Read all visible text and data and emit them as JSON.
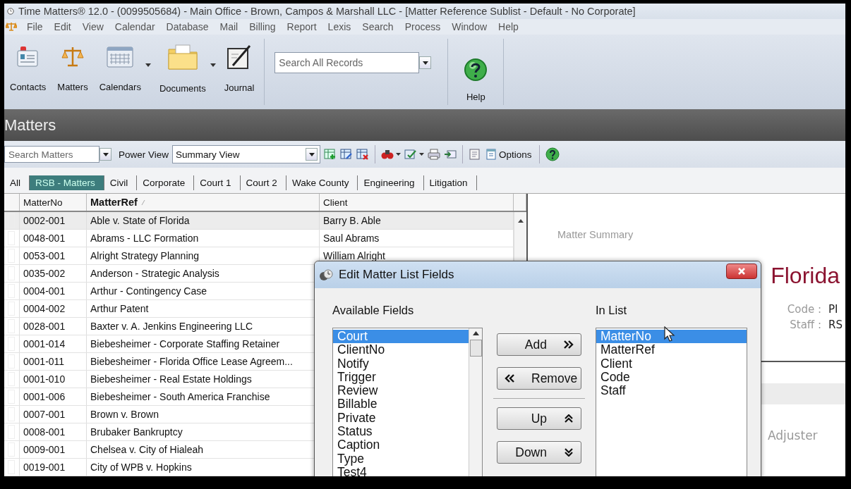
{
  "window": {
    "title": "Time Matters® 12.0 - (0099505684) - Main Office - Brown, Campos & Marshall LLC - [Matter Reference Sublist - Default - No Corporate]"
  },
  "menu": [
    "File",
    "Edit",
    "View",
    "Calendar",
    "Database",
    "Mail",
    "Billing",
    "Report",
    "Lexis",
    "Search",
    "Process",
    "Window",
    "Help"
  ],
  "toolbar": {
    "buttons": [
      {
        "label": "Contacts",
        "kind": "contacts",
        "dropdown": false
      },
      {
        "label": "Matters",
        "kind": "matters",
        "dropdown": false
      },
      {
        "label": "Calendars",
        "kind": "calendars",
        "dropdown": true
      },
      {
        "label": "Documents",
        "kind": "documents",
        "dropdown": true
      },
      {
        "label": "Journal",
        "kind": "journal",
        "dropdown": false
      }
    ],
    "search": {
      "placeholder": "Search All Records"
    },
    "help": {
      "label": "Help"
    }
  },
  "section": {
    "title": "Matters"
  },
  "list_toolbar": {
    "search": {
      "placeholder": "Search Matters"
    },
    "power_view_label": "Power View",
    "view": {
      "value": "Summary View"
    },
    "options_label": "Options"
  },
  "tabs": [
    {
      "label": "All",
      "selected": false
    },
    {
      "label": "RSB - Matters",
      "selected": true
    },
    {
      "label": "Civil",
      "selected": false
    },
    {
      "label": "Corporate",
      "selected": false
    },
    {
      "label": "Court 1",
      "selected": false
    },
    {
      "label": "Court 2",
      "selected": false
    },
    {
      "label": "Wake County",
      "selected": false
    },
    {
      "label": "Engineering",
      "selected": false
    },
    {
      "label": "Litigation",
      "selected": false
    }
  ],
  "table": {
    "columns": [
      {
        "label": "MatterNo",
        "sorted": false
      },
      {
        "label": "MatterRef",
        "sorted": true
      },
      {
        "label": "Client",
        "sorted": false
      }
    ],
    "rows": [
      {
        "matter_no": "0002-001",
        "matter_ref": "Able v. State of Florida",
        "client": "Barry B. Able",
        "selected": true
      },
      {
        "matter_no": "0048-001",
        "matter_ref": "Abrams - LLC Formation",
        "client": "Saul Abrams",
        "selected": false
      },
      {
        "matter_no": "0053-001",
        "matter_ref": "Alright Strategy Planning",
        "client": "William Alright",
        "selected": false
      },
      {
        "matter_no": "0035-002",
        "matter_ref": "Anderson - Strategic Analysis",
        "selected": false
      },
      {
        "matter_no": "0004-001",
        "matter_ref": "Arthur - Contingency Case",
        "selected": false
      },
      {
        "matter_no": "0004-002",
        "matter_ref": "Arthur Patent",
        "selected": false
      },
      {
        "matter_no": "0028-001",
        "matter_ref": "Baxter v. A. Jenkins Engineering LLC",
        "selected": false
      },
      {
        "matter_no": "0001-014",
        "matter_ref": "Biebesheimer - Corporate Staffing Retainer",
        "selected": false
      },
      {
        "matter_no": "0001-011",
        "matter_ref": "Biebesheimer - Florida Office Lease Agreem...",
        "selected": false
      },
      {
        "matter_no": "0001-010",
        "matter_ref": "Biebesheimer - Real Estate Holdings",
        "selected": false
      },
      {
        "matter_no": "0001-006",
        "matter_ref": "Biebesheimer - South America Franchise",
        "selected": false
      },
      {
        "matter_no": "0007-001",
        "matter_ref": "Brown v. Brown",
        "selected": false
      },
      {
        "matter_no": "0008-001",
        "matter_ref": "Brubaker Bankruptcy",
        "selected": false
      },
      {
        "matter_no": "0009-001",
        "matter_ref": "Chelsea v. City of Hialeah",
        "selected": false
      },
      {
        "matter_no": "0019-001",
        "matter_ref": "City of WPB v. Hopkins",
        "selected": false
      }
    ]
  },
  "summary": {
    "heading": "Matter Summary",
    "title": "Florida",
    "fields": [
      {
        "label": "Code :",
        "value": "PI"
      },
      {
        "label": "Staff :",
        "value": "RS"
      }
    ],
    "section_label": "Adjuster"
  },
  "dialog": {
    "title": "Edit Matter List Fields",
    "available": {
      "label": "Available Fields",
      "items": [
        {
          "label": "Court",
          "selected": true
        },
        {
          "label": "ClientNo",
          "selected": false
        },
        {
          "label": "Notify",
          "selected": false
        },
        {
          "label": "Trigger",
          "selected": false
        },
        {
          "label": "Review",
          "selected": false
        },
        {
          "label": "Billable",
          "selected": false
        },
        {
          "label": "Private",
          "selected": false
        },
        {
          "label": "Status",
          "selected": false
        },
        {
          "label": "Caption",
          "selected": false
        },
        {
          "label": "Type",
          "selected": false
        },
        {
          "label": "Test4",
          "selected": false
        }
      ]
    },
    "buttons": [
      {
        "label": "Add",
        "kind": "add"
      },
      {
        "label": "Remove",
        "kind": "remove"
      },
      {
        "label": "Up",
        "kind": "up"
      },
      {
        "label": "Down",
        "kind": "down"
      }
    ],
    "in_list": {
      "label": "In List",
      "items": [
        {
          "label": "MatterNo",
          "selected": true
        },
        {
          "label": "MatterRef",
          "selected": false
        },
        {
          "label": "Client",
          "selected": false
        },
        {
          "label": "Code",
          "selected": false
        },
        {
          "label": "Staff",
          "selected": false
        }
      ]
    }
  }
}
